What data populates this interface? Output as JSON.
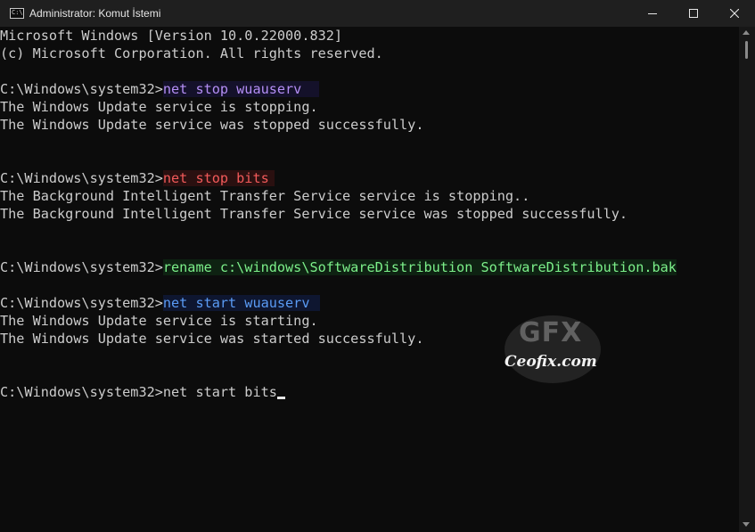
{
  "window": {
    "title": "Administrator: Komut İstemi",
    "icon_label": "C:\\",
    "icons": {
      "app": "cmd-icon",
      "minimize": "minimize-icon",
      "maximize": "maximize-icon",
      "close": "close-icon"
    }
  },
  "console": {
    "header": [
      "Microsoft Windows [Version 10.0.22000.832]",
      "(c) Microsoft Corporation. All rights reserved."
    ],
    "prompt": "C:\\Windows\\system32>",
    "blocks": [
      {
        "command": "net stop wuauserv",
        "output": [
          "The Windows Update service is stopping.",
          "The Windows Update service was stopped successfully."
        ]
      },
      {
        "command": "net stop bits",
        "output": [
          "The Background Intelligent Transfer Service service is stopping..",
          "The Background Intelligent Transfer Service service was stopped successfully."
        ]
      },
      {
        "command": "rename c:\\windows\\SoftwareDistribution SoftwareDistribution.bak",
        "output": []
      },
      {
        "command": "net start wuauserv",
        "output": [
          "The Windows Update service is starting.",
          "The Windows Update service was started successfully."
        ]
      },
      {
        "command": "net start bits",
        "output": []
      }
    ]
  },
  "watermark": {
    "logo": "GFX",
    "site": "Ceofix.com"
  },
  "colors": {
    "background": "#0c0c0c",
    "titlebar": "#1f1f1f",
    "text": "#cccccc",
    "cmd_purple": "#b48ef5",
    "cmd_red": "#f25a5a",
    "cmd_green": "#7cf08a",
    "cmd_blue": "#5a9bf5"
  }
}
